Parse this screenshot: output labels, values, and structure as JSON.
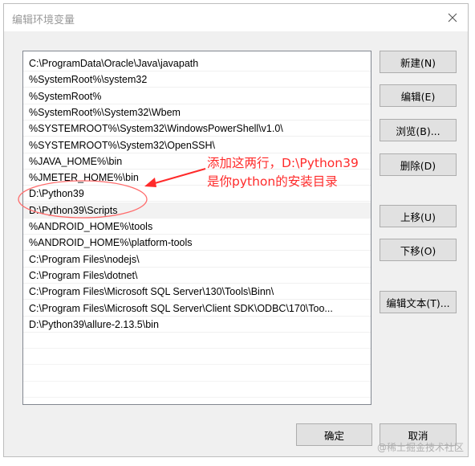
{
  "window": {
    "title": "编辑环境变量"
  },
  "path_list": [
    "C:\\ProgramData\\Oracle\\Java\\javapath",
    "%SystemRoot%\\system32",
    "%SystemRoot%",
    "%SystemRoot%\\System32\\Wbem",
    "%SYSTEMROOT%\\System32\\WindowsPowerShell\\v1.0\\",
    "%SYSTEMROOT%\\System32\\OpenSSH\\",
    "%JAVA_HOME%\\bin",
    "%JMETER_HOME%\\bin",
    "D:\\Python39",
    "D:\\Python39\\Scripts",
    "%ANDROID_HOME%\\tools",
    "%ANDROID_HOME%\\platform-tools",
    "C:\\Program Files\\nodejs\\",
    "C:\\Program Files\\dotnet\\",
    "C:\\Program Files\\Microsoft SQL Server\\130\\Tools\\Binn\\",
    "C:\\Program Files\\Microsoft SQL Server\\Client SDK\\ODBC\\170\\Too...",
    "D:\\Python39\\allure-2.13.5\\bin"
  ],
  "buttons": {
    "new": "新建(N)",
    "edit": "编辑(E)",
    "browse": "浏览(B)...",
    "delete": "删除(D)",
    "move_up": "上移(U)",
    "move_down": "下移(O)",
    "edit_text": "编辑文本(T)...",
    "ok": "确定",
    "cancel": "取消"
  },
  "annotation": {
    "line1": "添加这两行，D:\\Python39",
    "line2": "是你python的安装目录",
    "color": "#ff2a2a"
  },
  "watermark": "@稀土掘金技术社区",
  "colors": {
    "dialog_bg": "#f0f0f0",
    "button_bg": "#e1e1e1",
    "button_border": "#adadad",
    "selected_row": "#f2f2f2"
  }
}
